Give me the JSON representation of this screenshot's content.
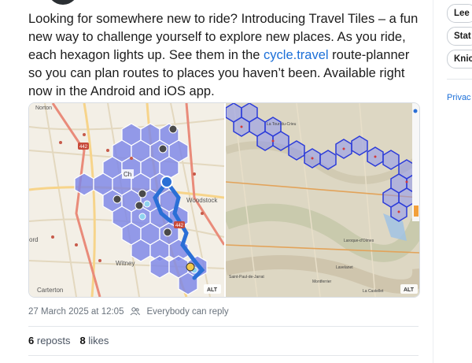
{
  "post": {
    "text_before_link": "Looking for somewhere new to ride? Introducing Travel Tiles – a fun new way to challenge yourself to explore new places. As you ride, each hexagon lights up. See them in the ",
    "link_text": "cycle.travel",
    "text_after_link": " route-planner so you can plan routes to places you haven’t been. Available right now in the Android and iOS app.",
    "timestamp": "27 March 2025 at 12:05",
    "reply_setting": "Everybody can reply",
    "reposts_count": "6",
    "reposts_label": "reposts",
    "likes_count": "8",
    "likes_label": "likes"
  },
  "map_left": {
    "labels": {
      "norton": "Norton",
      "woodstock": "Woodstock",
      "witney": "Witney",
      "carterton": "Carterton",
      "ford": "ord",
      "ch": "Ch",
      "road_442a": "442",
      "road_442b": "442"
    },
    "alt_badge": "ALT"
  },
  "map_right": {
    "labels": {
      "town_top": "La Tour-du-Crieu",
      "town_mid": "Lavelanet",
      "town_left": "Saint-Paul-de-Jarrat",
      "town_bottom": "Montferrier",
      "town_right": "Laroque-d'Olmes",
      "town_corner": "La Castellet"
    },
    "alt_badge": "ALT"
  },
  "sidebar": {
    "pill_1": "Lee",
    "pill_2": "Stat",
    "pill_3": "Knic",
    "privacy_link": "Privac"
  },
  "colors": {
    "link": "#1b6fd8",
    "hex_fill": "#7d86e8",
    "route": "#2a6fd6"
  }
}
